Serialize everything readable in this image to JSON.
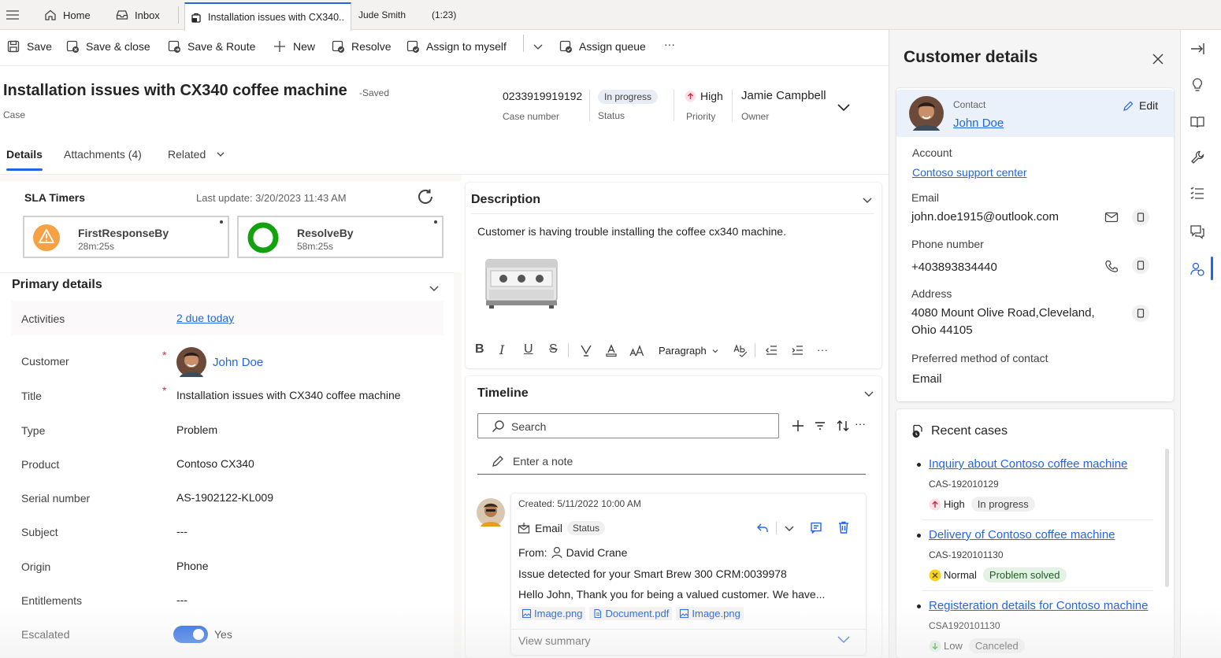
{
  "tabs": {
    "home": "Home",
    "inbox": "Inbox",
    "case_tab": "Installation issues with CX340..",
    "session_user": "Jude Smith",
    "session_time": "(1:23)"
  },
  "commands": {
    "save": "Save",
    "save_close": "Save & close",
    "save_route": "Save & Route",
    "new": "New",
    "resolve": "Resolve",
    "assign_myself": "Assign to myself",
    "assign_queue": "Assign queue",
    "more": "···"
  },
  "header": {
    "title": "Installation issues with CX340 coffee machine",
    "saved": "-Saved",
    "entity": "Case",
    "case_number": "0233919919192",
    "case_number_label": "Case number",
    "status": "In progress",
    "status_label": "Status",
    "priority": "High",
    "priority_label": "Priority",
    "owner": "Jamie Campbell",
    "owner_label": "Owner"
  },
  "form_tabs": {
    "details": "Details",
    "attachments": "Attachments (4)",
    "related": "Related"
  },
  "sla": {
    "title": "SLA Timers",
    "last_update": "Last update: 3/20/2023 11:43 AM",
    "timers": [
      {
        "name": "FirstResponseBy",
        "time": "28m:25s"
      },
      {
        "name": "ResolveBy",
        "time": "58m:25s"
      }
    ]
  },
  "primary": {
    "title": "Primary details",
    "activities_label": "Activities",
    "activities_value": "2 due today",
    "customer_label": "Customer",
    "customer_value": "John Doe",
    "title_label": "Title",
    "title_value": "Installation issues with CX340 coffee machine",
    "type_label": "Type",
    "type_value": "Problem",
    "product_label": "Product",
    "product_value": "Contoso CX340",
    "serial_label": "Serial number",
    "serial_value": "AS-1902122-KL009",
    "subject_label": "Subject",
    "subject_value": "---",
    "origin_label": "Origin",
    "origin_value": "Phone",
    "entitlements_label": "Entitlements",
    "entitlements_value": "---",
    "escalated_label": "Escalated",
    "escalated_value": "Yes",
    "required_mark": "*"
  },
  "description": {
    "title": "Description",
    "text": "Customer is having trouble installing the coffee cx340 machine.",
    "paragraph_label": "Paragraph",
    "toolbar": [
      "B",
      "I",
      "U",
      "S"
    ]
  },
  "timeline": {
    "title": "Timeline",
    "search_placeholder": "Search",
    "note_placeholder": "Enter a note",
    "activity": {
      "created": "Created: 5/11/2022 10:00 AM",
      "type": "Email",
      "status": "Status",
      "from_label": "From:",
      "from_name": "David Crane",
      "subject": "Issue detected for your Smart Brew 300 CRM:0039978",
      "body": "Hello John, Thank you for being a valued customer. We have...",
      "attachments": [
        "Image.png",
        "Document.pdf",
        "Image.png"
      ],
      "view_summary": "View summary"
    }
  },
  "customer_details": {
    "title": "Customer details",
    "contact_label": "Contact",
    "contact_name": "John Doe",
    "edit": "Edit",
    "account_label": "Account",
    "account_value": "Contoso support center",
    "email_label": "Email",
    "email_value": "john.doe1915@outlook.com",
    "phone_label": "Phone number",
    "phone_value": "+403893834440",
    "address_label": "Address",
    "address_line1": "4080 Mount Olive Road,Cleveland,",
    "address_line2": "Ohio 44105",
    "pref_label": "Preferred method of contact",
    "pref_value": "Email"
  },
  "recent_cases": {
    "title": "Recent cases",
    "items": [
      {
        "title": "Inquiry about Contoso coffee machine",
        "number": "CAS-192010129",
        "priority": "High",
        "status": "In progress"
      },
      {
        "title": "Delivery of Contoso coffee machine",
        "number": "CAS-1920101130",
        "priority": "Normal",
        "status": "Problem solved"
      },
      {
        "title": "Registeration details for Contoso machine",
        "number": "CSA1920101130",
        "priority": "Low",
        "status": "Canceled"
      }
    ]
  },
  "colors": {
    "accent": "#2266e3",
    "sla_warning": "#f7a145",
    "sla_ok": "#13a10e",
    "priority_high": "#c4314b"
  }
}
